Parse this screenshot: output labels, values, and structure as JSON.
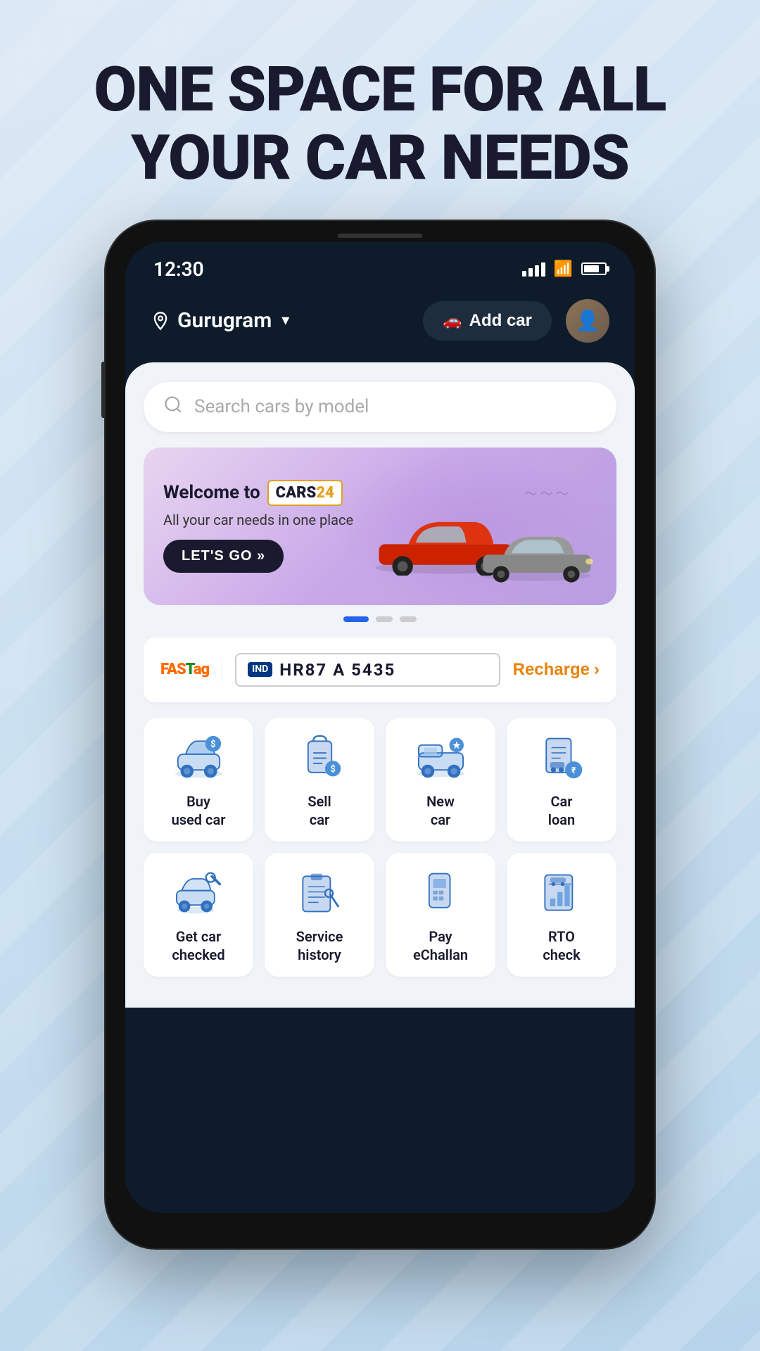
{
  "headline": "ONE SPACE FOR ALL YOUR CAR NEEDS",
  "status": {
    "time": "12:30",
    "signal": "signal-bars",
    "wifi": "wifi",
    "battery": "battery"
  },
  "header": {
    "location": "Gurugram",
    "add_car_label": "Add car",
    "avatar_initials": "👤"
  },
  "search": {
    "placeholder": "Search cars by model"
  },
  "banner": {
    "welcome_text": "Welcome to",
    "brand": "CARS24",
    "brand_number": "24",
    "subtitle": "All your car needs in one place",
    "cta": "LET'S GO »"
  },
  "fastag": {
    "logo": "FASTag",
    "plate_country": "IND",
    "plate_number": "HR87 A 5435",
    "recharge_label": "Recharge",
    "recharge_arrow": "›"
  },
  "menu_row1": [
    {
      "label": "Buy\nused car",
      "icon": "🚗"
    },
    {
      "label": "Sell\ncar",
      "icon": "🏷️"
    },
    {
      "label": "New\ncar",
      "icon": "🚙"
    },
    {
      "label": "Car\nloan",
      "icon": "📋"
    }
  ],
  "menu_row2": [
    {
      "label": "Get car\nchecked",
      "icon": "🔧"
    },
    {
      "label": "Service\nhistory",
      "icon": "📄"
    },
    {
      "label": "Pay\neChallan",
      "icon": "📱"
    },
    {
      "label": "RTO\ncheck",
      "icon": "📊"
    }
  ]
}
